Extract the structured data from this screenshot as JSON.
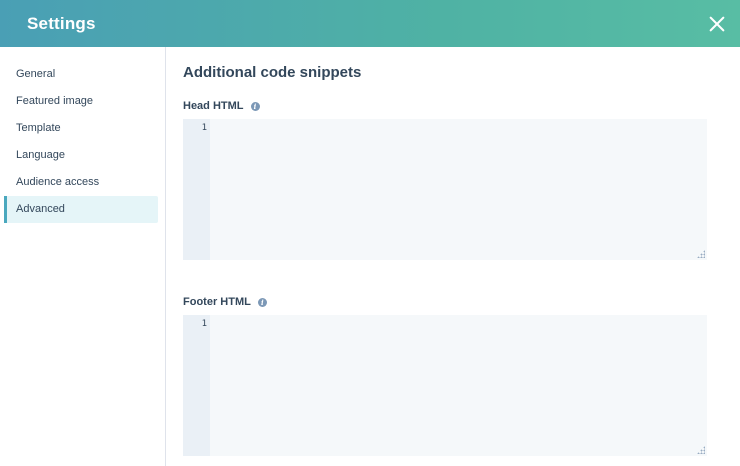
{
  "header": {
    "title": "Settings",
    "close_icon": "close-icon"
  },
  "sidebar": {
    "items": [
      {
        "label": "General",
        "active": false
      },
      {
        "label": "Featured image",
        "active": false
      },
      {
        "label": "Template",
        "active": false
      },
      {
        "label": "Language",
        "active": false
      },
      {
        "label": "Audience access",
        "active": false
      },
      {
        "label": "Advanced",
        "active": true
      }
    ]
  },
  "main": {
    "section_title": "Additional code snippets",
    "head_html": {
      "label": "Head HTML",
      "info_icon": "info-icon",
      "line_number": "1",
      "value": ""
    },
    "footer_html": {
      "label": "Footer HTML",
      "info_icon": "info-icon",
      "line_number": "1",
      "value": ""
    }
  },
  "colors": {
    "header_gradient_start": "#4a9fb5",
    "header_gradient_end": "#58bda4",
    "active_nav_bg": "#e5f5f8",
    "active_nav_border": "#4aa8be",
    "text": "#33475b",
    "editor_bg": "#f5f8fa",
    "gutter_bg": "#eaf0f6"
  }
}
